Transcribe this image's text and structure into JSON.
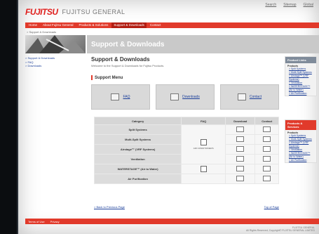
{
  "header": {
    "logo_mark": "FUJITSU",
    "logo_text": "FUJITSU GENERAL",
    "top_links": [
      "Search",
      "Sitemap",
      "Global"
    ]
  },
  "nav": {
    "items": [
      "Home",
      "About Fujitsu General",
      "Products & Solutions",
      "Support & Downloads",
      "Contact"
    ]
  },
  "breadcrumb": "> Support & Downloads",
  "banner_title": "Support & Downloads",
  "left_nav": [
    "> Support & Downloads",
    "> FAQ",
    "> Downloads"
  ],
  "main": {
    "title": "Support & Downloads",
    "intro": "Welcome to the Support & Downloads for Fujitsu Products.",
    "menu_title": "Support Menu",
    "menu_buttons": [
      "FAQ",
      "Downloads",
      "Contact"
    ]
  },
  "table": {
    "headers": [
      "Category",
      "FAQ",
      "Download",
      "Contact"
    ],
    "rows": [
      "Split Systems",
      "Multi-Split Systems",
      "Airstage™ (VRF Systems)",
      "Ventilation",
      "WATERSTAGE™ (Air to Water)",
      "Air Purification"
    ],
    "faq_label": "AIR CONDITIONERS"
  },
  "bottom_links": {
    "left": "> Back to Previous Page",
    "right": "Top of Page"
  },
  "right_boxes": [
    {
      "header": "Product Links",
      "subheader": "Products",
      "links": [
        "> Split Systems",
        "> Multi-Split Systems",
        "> Airstage™ (VRF Systems)",
        "> Ventilation",
        "> WATERSTAGE™ (Air to Water)",
        "> Air Purification"
      ]
    },
    {
      "header": "Products & Services",
      "subheader": "Products",
      "links": [
        "> Split Systems",
        "> Multi-Split Systems",
        "> Airstage™ (VRF Systems)",
        "> Ventilation",
        "> WATERSTAGE™ (Air to Water)",
        "> Air Purification"
      ]
    }
  ],
  "footer": {
    "links": [
      "Terms of Use",
      "Privacy"
    ],
    "company": "FUJITSU GENERAL",
    "copyright": "All Rights Reserved, Copyright© FUJITSU GENERAL LIMITED"
  },
  "colors": {
    "accent": "#e13a2b",
    "link": "#1a3e9a",
    "header_gray": "#c9c9c9"
  }
}
